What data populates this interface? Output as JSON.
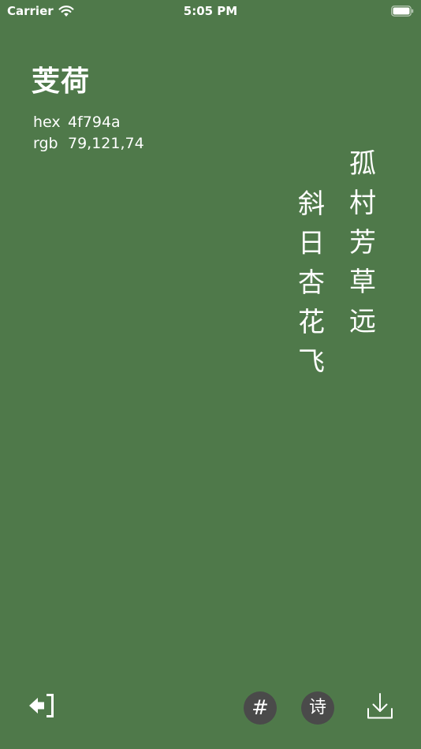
{
  "status_bar": {
    "carrier": "Carrier",
    "time": "5:05 PM"
  },
  "color": {
    "name": "芰荷",
    "hex_label": "hex",
    "hex_value": "4f794a",
    "rgb_label": "rgb",
    "rgb_value": "79,121,74"
  },
  "poem": {
    "column_1": [
      "孤",
      "村",
      "芳",
      "草",
      "远"
    ],
    "column_2": [
      "斜",
      "日",
      "杏",
      "花",
      "飞"
    ]
  },
  "toolbar": {
    "hash_label": "#",
    "poem_label": "诗"
  },
  "colors": {
    "background": "#4f794a",
    "button_fill": "#4a4a4a",
    "foreground": "#ffffff"
  },
  "icons": {
    "exit": "exit-icon",
    "download": "download-icon",
    "wifi": "wifi-icon",
    "battery": "battery-icon"
  }
}
